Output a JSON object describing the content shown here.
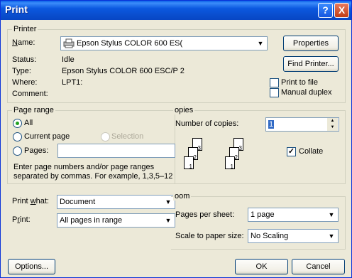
{
  "window": {
    "title": "Print"
  },
  "titlebar": {
    "help_glyph": "?",
    "close_glyph": "X"
  },
  "printer": {
    "group_label": "Printer",
    "name_label": "Name:",
    "name_value": "Epson Stylus COLOR 600 ES(",
    "properties_button": "Properties",
    "find_printer_button": "Find Printer...",
    "status_label": "Status:",
    "status_value": "Idle",
    "type_label": "Type:",
    "type_value": "Epson Stylus COLOR 600 ESC/P 2",
    "where_label": "Where:",
    "where_value": "LPT1:",
    "comment_label": "Comment:",
    "comment_value": "",
    "print_to_file_label": "Print to file",
    "manual_duplex_label": "Manual duplex",
    "print_to_file_checked": false,
    "manual_duplex_checked": false
  },
  "page_range": {
    "group_label": "Page range",
    "all_label": "All",
    "current_page_label": "Current page",
    "selection_label": "Selection",
    "pages_label": "Pages:",
    "pages_value": "",
    "selected": "All",
    "hint_line1": "Enter page numbers and/or page ranges",
    "hint_line2": "separated by commas.  For example, 1,3,5–12"
  },
  "copies": {
    "group_label": "opies",
    "number_label": "Number of copies:",
    "number_value": "1",
    "collate_label": "Collate",
    "collate_checked": true,
    "page_numbers": [
      "3",
      "2",
      "1"
    ]
  },
  "print_what": {
    "label": "Print what:",
    "value": "Document",
    "print_label": "Print:",
    "print_value": "All pages in range"
  },
  "zoom": {
    "group_label": "oom",
    "pages_per_sheet_label": "Pages per sheet:",
    "pages_per_sheet_value": "1 page",
    "scale_label": "Scale to paper size:",
    "scale_value": "No Scaling"
  },
  "footer": {
    "options_button": "Options...",
    "ok_button": "OK",
    "cancel_button": "Cancel"
  }
}
